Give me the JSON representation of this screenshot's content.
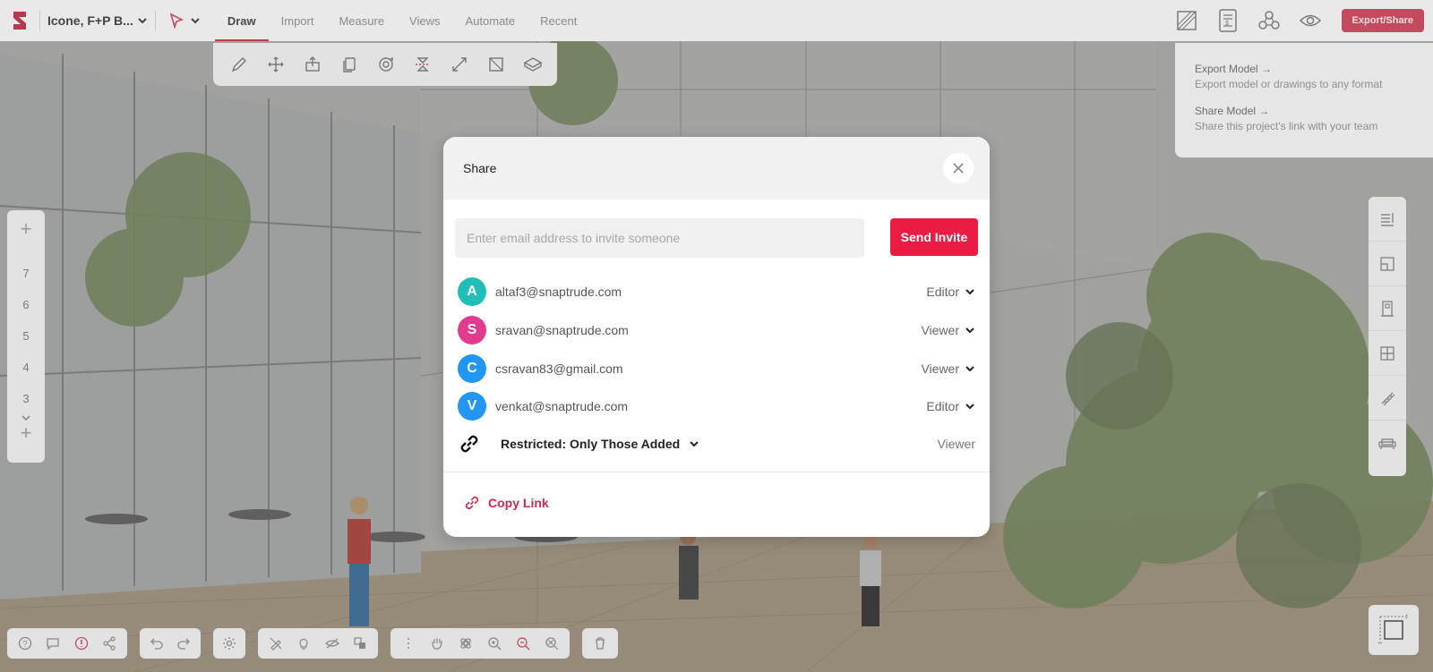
{
  "app": {
    "project_name": "Icone, F+P B...",
    "menu_tabs": [
      "Draw",
      "Import",
      "Measure",
      "Views",
      "Automate",
      "Recent"
    ],
    "active_tab": "Draw",
    "export_share_label": "Export/Share"
  },
  "export_menu": {
    "items": [
      {
        "title": "Export Model →",
        "description": "Export model or drawings to any format"
      },
      {
        "title": "Share Model →",
        "description": "Share this project's link with your team"
      }
    ]
  },
  "stories": {
    "levels": [
      "7",
      "6",
      "5",
      "4",
      "3"
    ],
    "add_symbol": "+"
  },
  "share_dialog": {
    "title": "Share",
    "email_placeholder": "Enter email address to invite someone",
    "email_value": "",
    "send_label": "Send Invite",
    "users": [
      {
        "initial": "A",
        "email": "altaf3@snaptrude.com",
        "role": "Editor",
        "color": "#1fbfb8"
      },
      {
        "initial": "S",
        "email": "sravan@snaptrude.com",
        "role": "Viewer",
        "color": "#e23a8e"
      },
      {
        "initial": "C",
        "email": "csravan83@gmail.com",
        "role": "Viewer",
        "color": "#2196f3"
      },
      {
        "initial": "V",
        "email": "venkat@snaptrude.com",
        "role": "Editor",
        "color": "#2196f3"
      }
    ],
    "access_label": "Restricted: Only Those Added",
    "access_role": "Viewer",
    "copy_link_label": "Copy Link"
  },
  "colors": {
    "accent": "#ec1b43",
    "brand": "#c44b5e",
    "link": "#d1284a"
  }
}
